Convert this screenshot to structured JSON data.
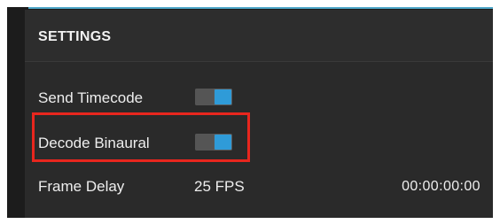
{
  "settings": {
    "title": "SETTINGS",
    "send_timecode": {
      "label": "Send Timecode",
      "enabled": true
    },
    "decode_binaural": {
      "label": "Decode Binaural",
      "enabled": true
    },
    "frame_delay": {
      "label": "Frame Delay",
      "fps": "25 FPS",
      "timecode": "00:00:00:00"
    }
  },
  "colors": {
    "accent": "#2f9bd8",
    "highlight": "#e8261e",
    "panel": "#2a2a2a"
  }
}
